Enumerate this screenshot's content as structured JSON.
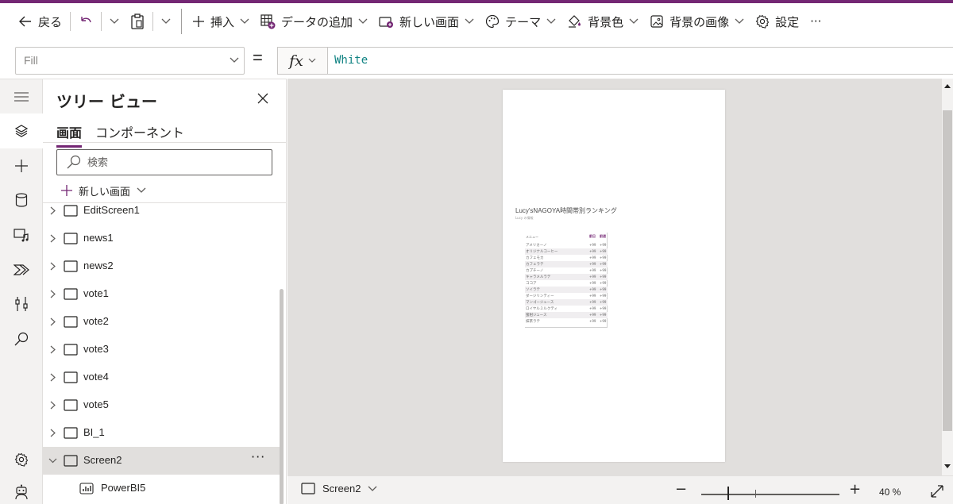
{
  "colors": {
    "accent": "#742774",
    "formula_text": "#0f8282",
    "rail_bg": "#f3f2f1",
    "canvas_bg": "#e1dfdd"
  },
  "toolbar": {
    "back": "戻る",
    "insert": "挿入",
    "add_data": "データの追加",
    "new_screen": "新しい画面",
    "theme": "テーマ",
    "bg_color": "背景色",
    "bg_image": "背景の画像",
    "settings": "設定",
    "more": "···"
  },
  "formula": {
    "property": "Fill",
    "equals": "=",
    "fx": "fx",
    "value": "White"
  },
  "rail": [
    "menu-icon",
    "layers-icon",
    "plus-icon",
    "database-icon",
    "media-icon",
    "power-automate-icon",
    "tools-icon",
    "search-icon",
    "settings-icon",
    "virtual-agent-icon"
  ],
  "tree": {
    "title": "ツリー ビュー",
    "tabs": [
      "画面",
      "コンポーネント"
    ],
    "search_placeholder": "検索",
    "new_screen": "新しい画面",
    "items": [
      "EditScreen1",
      "news1",
      "news2",
      "vote1",
      "vote2",
      "vote3",
      "vote4",
      "vote5",
      "BI_1",
      "Screen2"
    ],
    "selected_more": "···",
    "child": "PowerBI5"
  },
  "report": {
    "title": "Lucy'sNAGOYA時間帯別ランキング",
    "subtitle": "Lucy の情報",
    "headers": [
      "メニュー",
      "前日",
      "前週"
    ],
    "rows": [
      {
        "name": "アメリカーノ",
        "a": "+99",
        "b": "+99"
      },
      {
        "name": "オリジナルコーヒー",
        "a": "+99",
        "b": "+99"
      },
      {
        "name": "カフェモカ",
        "a": "+99",
        "b": "+99"
      },
      {
        "name": "カフェラテ",
        "a": "+99",
        "b": "+99"
      },
      {
        "name": "カプチーノ",
        "a": "+99",
        "b": "+99"
      },
      {
        "name": "キャラメルラテ",
        "a": "+99",
        "b": "+99"
      },
      {
        "name": "ココア",
        "a": "+99",
        "b": "+99"
      },
      {
        "name": "ソイラテ",
        "a": "+99",
        "b": "+99"
      },
      {
        "name": "ダージリンティー",
        "a": "+99",
        "b": "+99"
      },
      {
        "name": "マンゴージュース",
        "a": "+99",
        "b": "+99"
      },
      {
        "name": "ロイヤルミルクティ",
        "a": "+99",
        "b": "+99"
      },
      {
        "name": "蜜柑ジュース",
        "a": "+99",
        "b": "+99"
      },
      {
        "name": "抹茶ラテ",
        "a": "+99",
        "b": "+99"
      }
    ]
  },
  "status": {
    "screen": "Screen2",
    "zoom_minus": "−",
    "zoom_plus": "+",
    "zoom": "40 %"
  }
}
